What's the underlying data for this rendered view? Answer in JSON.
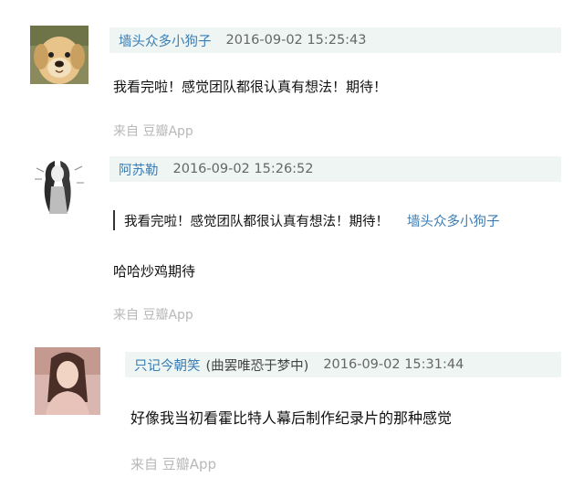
{
  "comments": [
    {
      "username": "墙头众多小狗子",
      "time": "2016-09-02 15:25:43",
      "text": "我看完啦！感觉团队都很认真有想法！期待！",
      "source": "来自 豆瓣App",
      "avatar_icon": "dog-avatar"
    },
    {
      "username": "阿苏勒",
      "time": "2016-09-02 15:26:52",
      "quote_text": "我看完啦！感觉团队都很认真有想法！期待！",
      "quote_user": "墙头众多小狗子",
      "text": "哈哈炒鸡期待",
      "source": "来自 豆瓣App",
      "avatar_icon": "sketch-woman-avatar"
    },
    {
      "username": "只记今朝笑",
      "username_extra": "(曲罢唯恐于梦中)",
      "time": "2016-09-02 15:31:44",
      "text": "好像我当初看霍比特人幕后制作纪录片的那种感觉",
      "source": "来自 豆瓣App",
      "avatar_icon": "photo-avatar"
    }
  ],
  "colors": {
    "username": "#3a7db5",
    "header_bg": "#eef5f3",
    "source": "#b8b8b8"
  }
}
